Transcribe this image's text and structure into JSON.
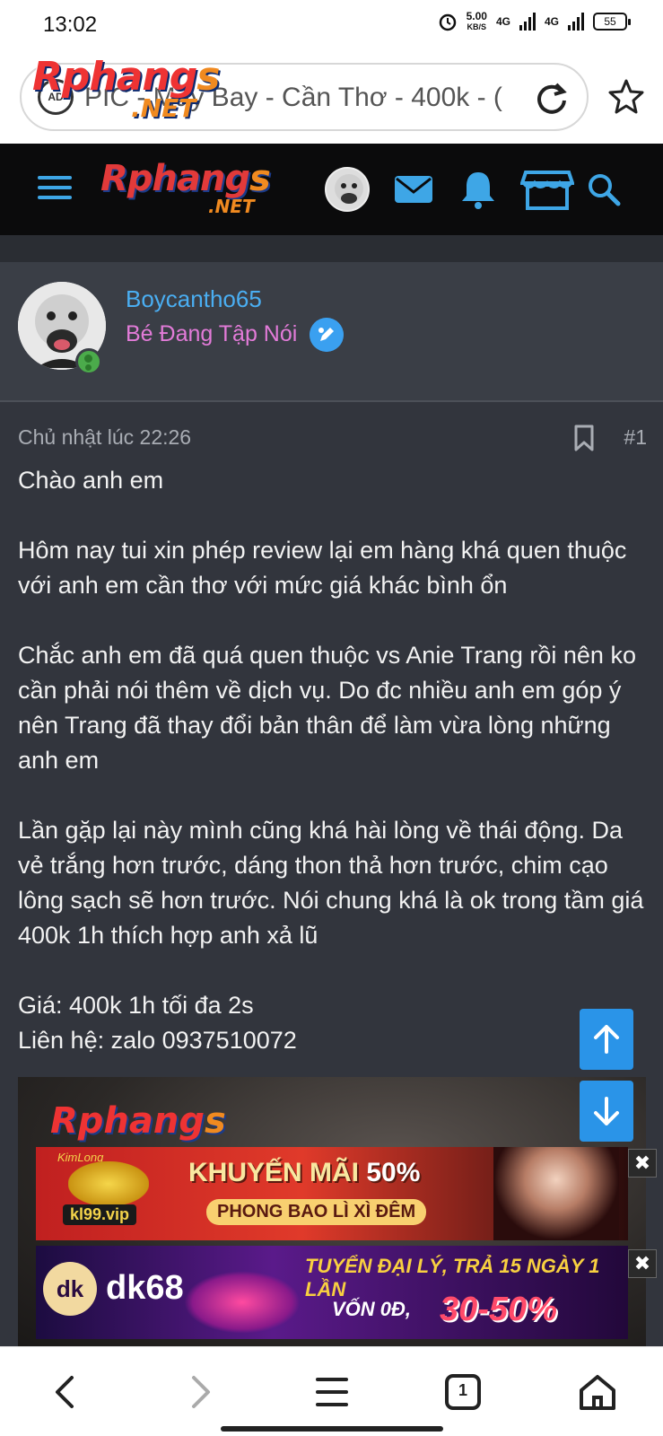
{
  "status_bar": {
    "time": "13:02",
    "speed_value": "5.00",
    "speed_unit": "KB/S",
    "net1": "4G",
    "net2": "4G",
    "battery": "55"
  },
  "browser": {
    "url_text": "PIC - Máy Bay - Cần Thơ - 400k - (",
    "lock_label": "AD",
    "overlay_logo_main": "Rphang",
    "overlay_logo_s": "s",
    "overlay_logo_net": ".NET"
  },
  "site_header": {
    "logo_main": "Rphang",
    "logo_s": "s",
    "logo_net": ".NET",
    "accent_color": "#3ea6e6"
  },
  "post": {
    "author": "Boycantho65",
    "user_title": "Bé Đang Tập Nói",
    "timestamp": "Chủ nhật lúc 22:26",
    "post_number": "#1",
    "paragraphs": [
      "Chào anh em",
      "Hôm nay tui xin phép review lại em hàng khá quen thuộc với anh em cần thơ với mức giá khác bình ổn",
      "Chắc anh em đã quá quen thuộc vs Anie Trang rồi nên ko cần phải nói thêm về dịch vụ. Do đc nhiều anh em góp ý nên Trang đã thay đổi bản thân để làm vừa lòng những anh em",
      "Lần gặp lại này mình cũng khá hài lòng về thái động. Da vẻ trắng hơn trước, dáng thon thả hơn trước, chim cạo lông sạch sẽ hơn trước. Nói chung khá là ok trong tầm giá 400k 1h thích hợp anh xả lũ"
    ],
    "price_line": "Giá: 400k 1h tối đa 2s",
    "contact_line": "Liên hệ: zalo 0937510072",
    "image_watermark_main": "Rphang",
    "image_watermark_s": "s"
  },
  "ads": {
    "ad1": {
      "brand_top": "KimLong",
      "brand": "kl99.vip",
      "headline_a": "KHUYẾN MÃI",
      "headline_b": "50%",
      "sub": "PHONG BAO LÌ XÌ ĐÊM"
    },
    "ad2": {
      "logo": "dk",
      "name": "dk68",
      "line1": "TUYỂN ĐẠI LÝ, TRẢ 15 NGÀY 1 LẦN",
      "line2": "VỐN 0Đ,",
      "line3": "30-50%"
    },
    "close_glyph": "✖"
  },
  "bottom_nav": {
    "tab_count": "1"
  },
  "icons": {
    "back": "chevron-left-icon",
    "forward": "chevron-right-icon",
    "menu": "menu-icon",
    "tabs": "tabs-icon",
    "home": "home-icon"
  }
}
